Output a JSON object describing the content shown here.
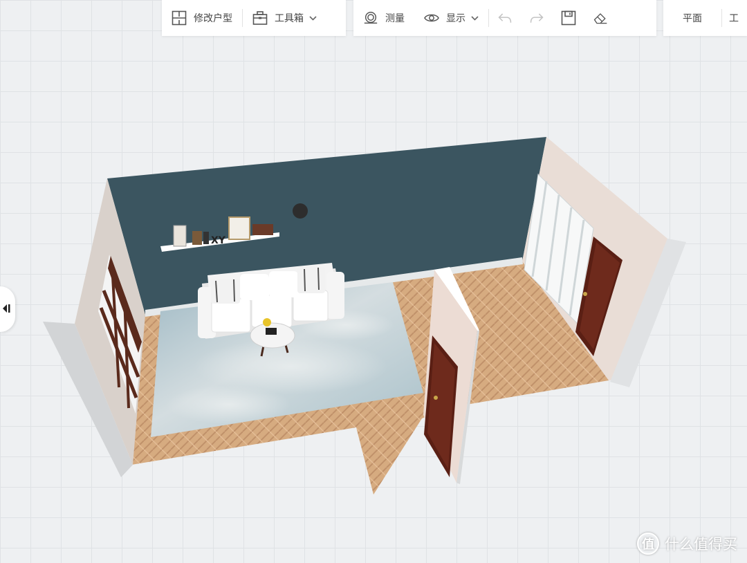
{
  "toolbar": {
    "group1": {
      "modify_layout_label": "修改户型",
      "toolbox_label": "工具箱"
    },
    "group2": {
      "measure_label": "测量",
      "display_label": "显示"
    },
    "group3": {
      "plan_label": "平面",
      "partial_label": "工"
    }
  },
  "icons": {
    "modify_layout": "floorplan-icon",
    "toolbox": "toolbox-icon",
    "measure": "measure-icon",
    "display": "eye-icon",
    "undo": "undo-icon",
    "redo": "redo-icon",
    "save": "save-icon",
    "clear": "eraser-icon",
    "side": "collapse-left-icon"
  },
  "watermark": {
    "badge": "值",
    "text": "什么值得买"
  },
  "colors": {
    "accent_wall": "#3b5560",
    "side_wall": "#e3ddd8",
    "floor_wood": "#d4a97f",
    "rug": "#b9cbd2",
    "door": "#5a1f14",
    "grid": "#dfe2e5"
  }
}
